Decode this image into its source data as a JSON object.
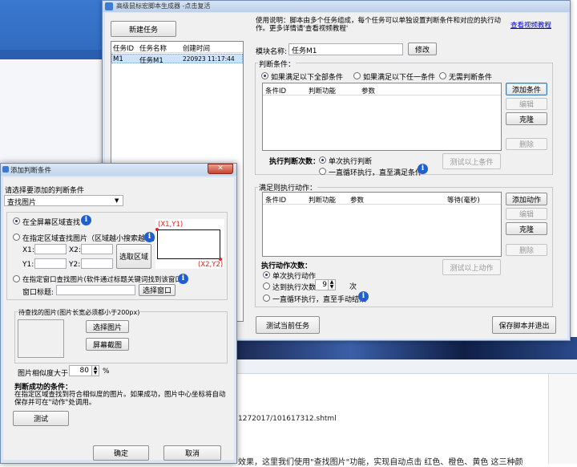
{
  "desktop": {
    "bg_text_url": "1272017/101617312.shtml",
    "bg_text_bottom": "效果，这里我们使用\"查找图片\"功能，实现自动点击 红色、橙色、黄色 这三种颜"
  },
  "main": {
    "title": "高级鼠标宏脚本生成器 -点击复活",
    "new_task": "新建任务",
    "help_text": "使用说明：脚本由多个任务组成，每个任务可以单独设置判断条件和对应的执行动作。更多详情请'查看视频教程'",
    "video_link": "查看视频教程",
    "task_cols": [
      "任务ID",
      "任务名称",
      "创建时间"
    ],
    "tasks": [
      {
        "id": "M1",
        "name": "任务M1",
        "time": "220923 11:17:44"
      }
    ],
    "module_label": "模块名称:",
    "module_value": "任务M1",
    "modify": "修改",
    "cond_group": "判断条件：",
    "cond_opts": [
      "如果满足以下全部条件",
      "如果满足以下任一条件",
      "无需判断条件"
    ],
    "cond_cols": [
      "条件ID",
      "判断功能",
      "参数"
    ],
    "add_cond": "添加条件",
    "edit": "编辑",
    "clone": "克隆",
    "delete": "删除",
    "judge_times": "执行判断次数：",
    "judge_once": "单次执行判断",
    "judge_loop": "一直循环执行，直至满足条件",
    "test_cond": "测试以上条件",
    "act_group": "满足则执行动作：",
    "act_cols": [
      "条件ID",
      "判断功能",
      "参数",
      "等待(毫秒)"
    ],
    "add_act": "添加动作",
    "act_times": "执行动作次数：",
    "act_once": "单次执行动作",
    "act_n": "达到执行次数",
    "act_n_value": "9",
    "act_n_unit": "次",
    "act_loop": "一直循环执行，直至手动结束",
    "test_act": "测试以上动作",
    "test_task": "测试当前任务",
    "save_exit": "保存脚本并退出"
  },
  "dialog": {
    "title": "添加判断条件",
    "choose_label": "请选择要添加的判断条件",
    "select_value": "查找图片",
    "opt_fullscreen": "在全屏幕区域查找",
    "opt_region": "在指定区域查找图片（区域越小搜索越快）",
    "x1": "X1:",
    "x2": "X2:",
    "y1": "Y1:",
    "y2": "Y2:",
    "pick_region": "选取区域",
    "corner1": "(X1,Y1)",
    "corner2": "(X2,Y2)",
    "opt_window": "在指定窗口查找图片(软件通过标题关键词找到该窗口)",
    "window_title": "窗口标题:",
    "pick_window": "选择窗口",
    "img_label": "待查找的图片(图片长宽必须都小于200px)",
    "pick_image": "选择图片",
    "screenshot": "屏幕截图",
    "similarity": "图片相似度大于",
    "similarity_value": "80",
    "percent": "%",
    "success_title": "判断成功的条件：",
    "success_text": "在指定区域查找到符合相似度的图片。如果成功，图片中心坐标将自动保存并可在\"动作\"处调用。",
    "test": "测试",
    "ok": "确定",
    "cancel": "取消"
  },
  "colors": {
    "title_bar": "#c6d8ee",
    "accent_red": "#e02020",
    "link": "#0000cc"
  }
}
